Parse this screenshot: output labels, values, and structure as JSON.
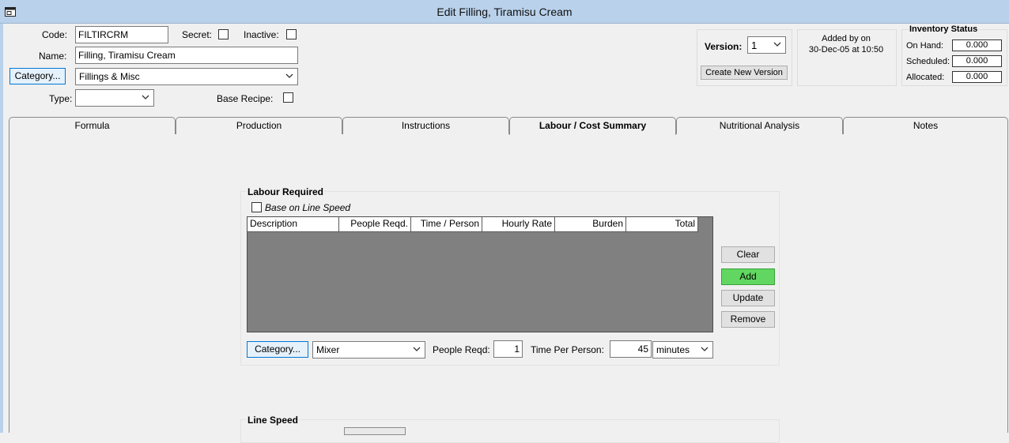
{
  "window": {
    "title": "Edit Filling, Tiramisu Cream"
  },
  "header": {
    "code_label": "Code:",
    "code_value": "FILTIRCRM",
    "secret_label": "Secret:",
    "inactive_label": "Inactive:",
    "name_label": "Name:",
    "name_value": "Filling, Tiramisu Cream",
    "category_button": "Category...",
    "category_value": "Fillings & Misc",
    "type_label": "Type:",
    "type_value": "",
    "base_recipe_label": "Base Recipe:"
  },
  "version": {
    "label": "Version:",
    "value": "1",
    "create_button": "Create New Version"
  },
  "added": {
    "line1": "Added by  on",
    "line2": "30-Dec-05 at 10:50"
  },
  "inventory": {
    "title": "Inventory Status",
    "rows": [
      {
        "label": "On Hand:",
        "value": "0.000"
      },
      {
        "label": "Scheduled:",
        "value": "0.000"
      },
      {
        "label": "Allocated:",
        "value": "0.000"
      }
    ]
  },
  "tabs": [
    {
      "label": "Formula"
    },
    {
      "label": "Production"
    },
    {
      "label": "Instructions"
    },
    {
      "label": "Labour / Cost Summary"
    },
    {
      "label": "Nutritional Analysis"
    },
    {
      "label": "Notes"
    }
  ],
  "labour": {
    "title": "Labour Required",
    "base_on_line_speed": "Base on Line Speed",
    "columns": [
      "Description",
      "People Reqd.",
      "Time / Person",
      "Hourly Rate",
      "Burden",
      "Total"
    ],
    "buttons": {
      "clear": "Clear",
      "add": "Add",
      "update": "Update",
      "remove": "Remove"
    },
    "category_button": "Category...",
    "category_value": "Mixer",
    "people_label": "People Reqd:",
    "people_value": "1",
    "time_label": "Time Per Person:",
    "time_value": "45",
    "time_unit": "minutes"
  },
  "line_speed": {
    "title": "Line Speed"
  },
  "colors": {
    "titlebar": "#b9d1ea",
    "add_button": "#61d761",
    "grid": "#808080"
  }
}
